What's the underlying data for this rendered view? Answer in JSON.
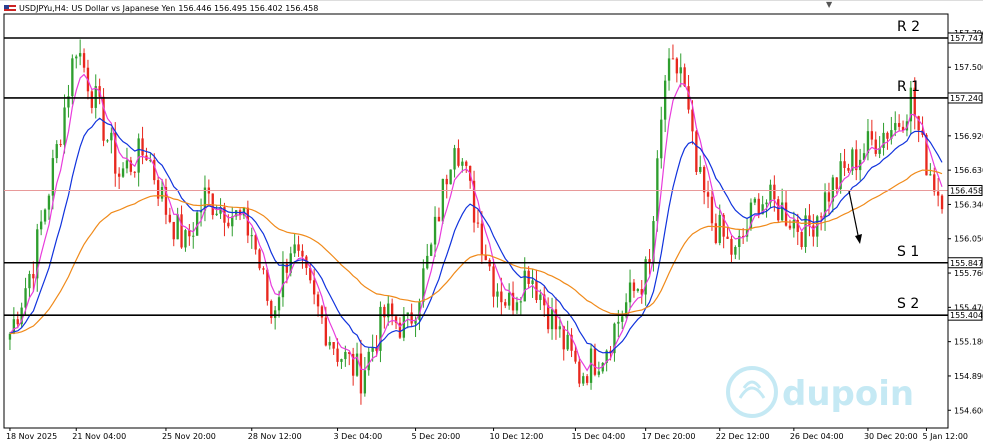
{
  "header": {
    "symbol": "USDJPYu,H4:",
    "description": "US Dollar vs Japanese Yen",
    "ohlc": "156.446 156.495 156.402 156.458"
  },
  "watermark": "dupoin",
  "chart_data": {
    "type": "candlestick",
    "ylim": [
      154.45,
      157.95
    ],
    "y_ticks": [
      "157.790",
      "157.500",
      "156.920",
      "156.630",
      "156.340",
      "156.050",
      "155.760",
      "155.470",
      "155.180",
      "154.890",
      "154.600"
    ],
    "x_ticks": [
      "18 Nov 2025",
      "21 Nov 04:00",
      "25 Nov 20:00",
      "28 Nov 12:00",
      "3 Dec 04:00",
      "5 Dec 20:00",
      "10 Dec 12:00",
      "15 Dec 04:00",
      "17 Dec 20:00",
      "22 Dec 12:00",
      "26 Dec 04:00",
      "30 Dec 20:00",
      "5 Jan 12:00"
    ],
    "levels": [
      {
        "name": "R 2",
        "value": 157.747
      },
      {
        "name": "R 1",
        "value": 157.24
      },
      {
        "name": "S 1",
        "value": 155.847
      },
      {
        "name": "S 2",
        "value": 155.404
      }
    ],
    "level_labels": [
      "157.747",
      "157.240",
      "155.847",
      "155.404"
    ],
    "current_price": 156.458,
    "current_price_label": "156.458",
    "path_keypoints": [
      [
        0,
        155.25
      ],
      [
        6,
        155.85
      ],
      [
        12,
        156.8
      ],
      [
        17,
        157.7
      ],
      [
        22,
        157.2
      ],
      [
        28,
        156.6
      ],
      [
        35,
        156.8
      ],
      [
        40,
        156.3
      ],
      [
        45,
        156.0
      ],
      [
        50,
        156.4
      ],
      [
        56,
        156.3
      ],
      [
        62,
        156.1
      ],
      [
        67,
        155.4
      ],
      [
        72,
        156.0
      ],
      [
        78,
        155.5
      ],
      [
        84,
        155.1
      ],
      [
        90,
        154.9
      ],
      [
        96,
        155.4
      ],
      [
        102,
        155.3
      ],
      [
        108,
        155.95
      ],
      [
        114,
        156.95
      ],
      [
        119,
        156.3
      ],
      [
        124,
        155.7
      ],
      [
        128,
        155.5
      ],
      [
        133,
        155.8
      ],
      [
        140,
        155.3
      ],
      [
        146,
        154.9
      ],
      [
        152,
        155.1
      ],
      [
        158,
        155.5
      ],
      [
        164,
        155.8
      ],
      [
        168,
        157.4
      ],
      [
        172,
        157.5
      ],
      [
        176,
        156.6
      ],
      [
        180,
        156.2
      ],
      [
        186,
        155.9
      ],
      [
        192,
        156.4
      ],
      [
        198,
        156.3
      ],
      [
        204,
        156.1
      ],
      [
        210,
        156.45
      ],
      [
        216,
        156.7
      ],
      [
        222,
        156.9
      ],
      [
        228,
        157.05
      ],
      [
        231,
        157.25
      ],
      [
        234,
        156.8
      ],
      [
        238,
        156.45
      ]
    ],
    "series": [
      {
        "name": "fast MA",
        "color": "#e83cdc"
      },
      {
        "name": "mid MA",
        "color": "#1133dd"
      },
      {
        "name": "slow MA",
        "color": "#f08a1a"
      }
    ],
    "bull_color": "#2e9e2e",
    "bear_color": "#e8281e"
  }
}
